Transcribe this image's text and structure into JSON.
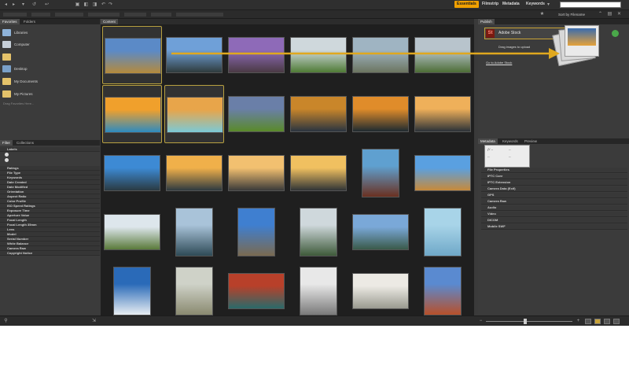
{
  "workspaces": [
    "Essentials",
    "Filmstrip",
    "Metadata",
    "Keywords"
  ],
  "sort": {
    "label": "Sort by Filename"
  },
  "left_tabs": [
    "Favorites",
    "Folders"
  ],
  "favorites": [
    {
      "label": "Libraries",
      "color": "#8fb3d9"
    },
    {
      "label": "Computer",
      "color": "#c6cfd8"
    },
    {
      "label": "",
      "color": "#e4c26a"
    },
    {
      "label": "Desktop",
      "color": "#7aa0c8"
    },
    {
      "label": "My Documents",
      "color": "#e4c26a"
    },
    {
      "label": "My Pictures",
      "color": "#e4c26a"
    }
  ],
  "favorites_hint": "Drag Favorites Here...",
  "filter_tabs": [
    "Filter",
    "Collections"
  ],
  "filters": [
    "Labels",
    "Ratings",
    "File Type",
    "Keywords",
    "Date Created",
    "Date Modified",
    "Orientation",
    "Aspect Ratio",
    "Color Profile",
    "ISO Speed Ratings",
    "Exposure Time",
    "Aperture Value",
    "Focal Length",
    "Focal Length 35mm",
    "Lens",
    "Model",
    "Serial Number",
    "White Balance",
    "Camera Raw",
    "Copyright Notice"
  ],
  "content_tab": "Content",
  "stock": {
    "tab": "Publish",
    "logo": "St",
    "name": "Adobe Stock",
    "drag_text": "Drag images to upload",
    "link": "Go to Adobe Stock"
  },
  "meta_tabs": [
    "Metadata",
    "Keywords",
    "Preview"
  ],
  "meta_box_rows": [
    "ƒ/ --",
    "--",
    "--",
    "--"
  ],
  "meta_sections": [
    "File Properties",
    "IPTC Core",
    "IPTC Extension",
    "Camera Data (Exif)",
    "GPS",
    "Camera Raw",
    "Audio",
    "Video",
    "DICOM",
    "Mobile SWF"
  ],
  "accent": "#f0a000",
  "thumbnails": [
    [
      {
        "top": "#5b8ac7",
        "bottom": "#b58a3c"
      },
      {
        "top": "#6fa0d8",
        "bottom": "#2f3b3c"
      },
      {
        "top": "#8e6ab8",
        "bottom": "#4a3a44"
      },
      {
        "top": "#cfd8dc",
        "bottom": "#4f7b35"
      },
      {
        "top": "#9fb4c2",
        "bottom": "#6c7560"
      },
      {
        "top": "#b8c4cc",
        "bottom": "#4d6d36"
      }
    ],
    [
      {
        "top": "#f0a02c",
        "bottom": "#2e8bbf"
      },
      {
        "top": "#e8a54a",
        "bottom": "#7bc9d6"
      },
      {
        "top": "#6a7fa8",
        "bottom": "#5a8a2a"
      },
      {
        "top": "#c9862a",
        "bottom": "#2a3440"
      },
      {
        "top": "#e08c2a",
        "bottom": "#1e2a30"
      },
      {
        "top": "#efb05a",
        "bottom": "#2b3238"
      }
    ],
    [
      {
        "top": "#3d8ad4",
        "bottom": "#2a3a42"
      },
      {
        "top": "#f0b04a",
        "bottom": "#2e3a40"
      },
      {
        "top": "#f2c070",
        "bottom": "#3a3a3a"
      },
      {
        "top": "#f0c060",
        "bottom": "#303436"
      },
      {
        "top": "#5fa0d0",
        "bottom": "#6a3020"
      },
      {
        "top": "#5aa0e0",
        "bottom": "#c88a3a"
      }
    ],
    [
      {
        "top": "#dde6ec",
        "bottom": "#5a7a3a"
      },
      {
        "top": "#a9c3d9",
        "bottom": "#2e4a56"
      },
      {
        "top": "#3f7fd0",
        "bottom": "#7a6a50"
      },
      {
        "top": "#cfd8dc",
        "bottom": "#3e5a3a"
      },
      {
        "top": "#7aa8d8",
        "bottom": "#3a5a4a"
      },
      {
        "top": "#a8d4e8",
        "bottom": "#6fa8c8"
      }
    ],
    [
      {
        "top": "#2a6ab8",
        "bottom": "#e8eef2"
      },
      {
        "top": "#cfd2c8",
        "bottom": "#8a8a70"
      },
      {
        "top": "#b8402a",
        "bottom": "#2a6a6a"
      },
      {
        "top": "#e8e8e8",
        "bottom": "#7a7a7a"
      },
      {
        "top": "#eceae4",
        "bottom": "#9a9a90"
      },
      {
        "top": "#5a8ad0",
        "bottom": "#b8502a"
      }
    ]
  ]
}
